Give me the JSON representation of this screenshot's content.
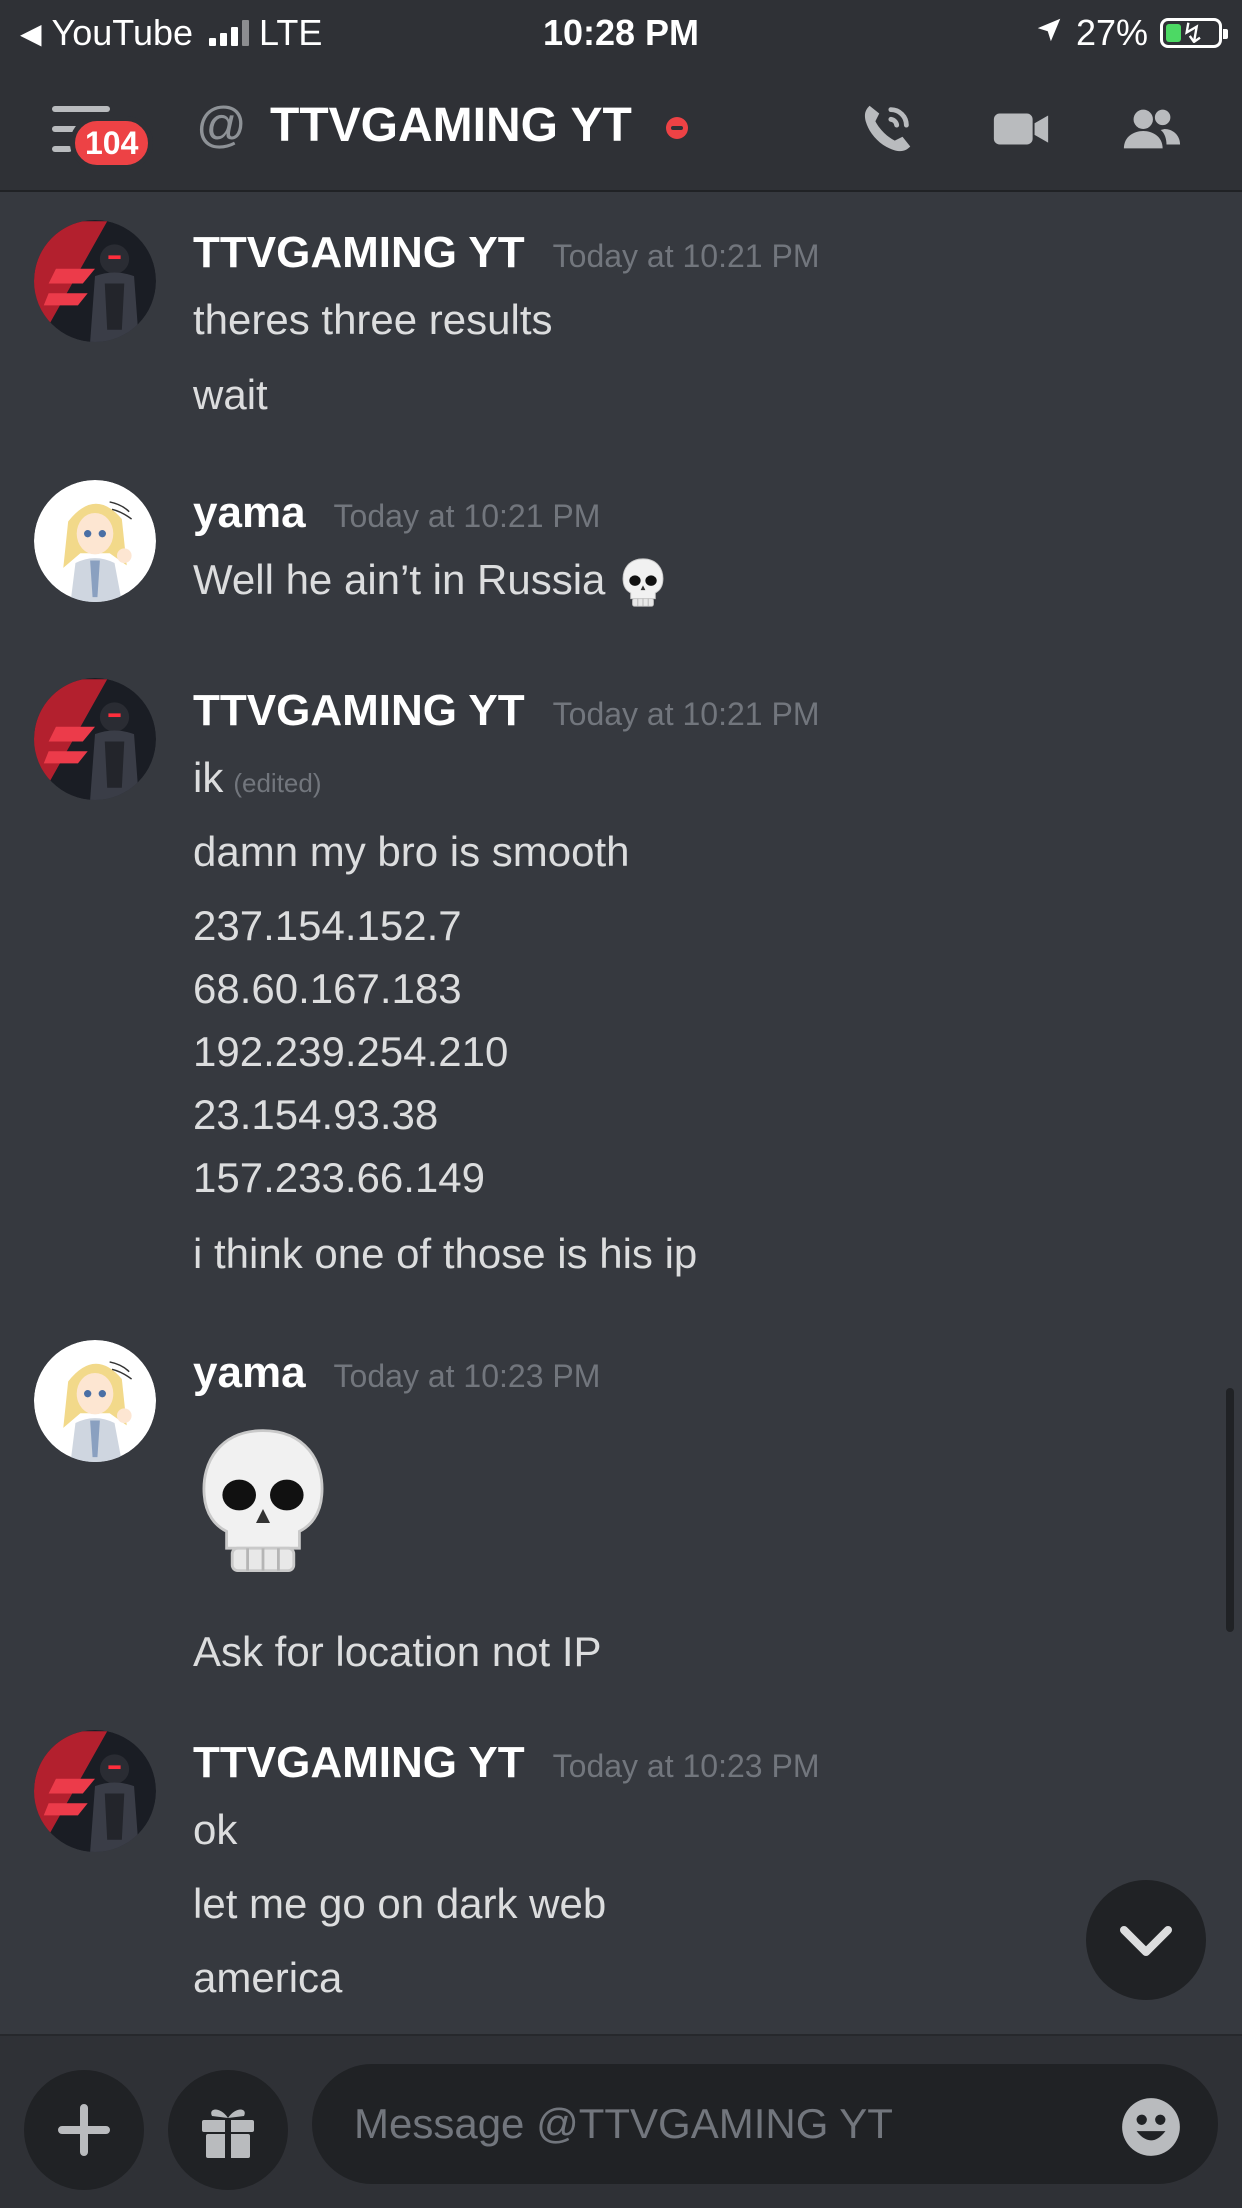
{
  "status_bar": {
    "back_app": "YouTube",
    "network": "LTE",
    "time": "10:28 PM",
    "battery": "27%",
    "battery_level": 0.27
  },
  "header": {
    "unread_badge": "104",
    "at_symbol": "@",
    "title": "TTVGAMING YT",
    "status": "dnd",
    "icons": [
      "menu-icon",
      "phone-call-icon",
      "video-call-icon",
      "members-icon"
    ]
  },
  "messages": [
    {
      "username": "TTVGAMING YT",
      "timestamp": "Today at 10:21 PM",
      "avatar": "ttv-avatar",
      "lines": [
        "theres three results",
        "wait"
      ]
    },
    {
      "username": "yama",
      "timestamp": "Today at 10:21 PM",
      "avatar": "yama-avatar",
      "lines": [
        "Well he ain’t in Russia"
      ],
      "emoji": "skull"
    },
    {
      "username": "TTVGAMING YT",
      "timestamp": "Today at 10:21 PM",
      "avatar": "ttv-avatar",
      "lines": [
        "ik",
        "damn my bro is smooth",
        "237.154.152.7",
        "68.60.167.183",
        "192.239.254.210",
        "23.154.93.38",
        "157.233.66.149",
        "i think one of those is his ip"
      ],
      "edited_label": "(edited)"
    },
    {
      "username": "yama",
      "timestamp": "Today at 10:23 PM",
      "avatar": "yama-avatar",
      "lines": [
        "Ask for location not IP"
      ],
      "emoji": "skull"
    },
    {
      "username": "TTVGAMING YT",
      "timestamp": "Today at 10:23 PM",
      "avatar": "ttv-avatar",
      "lines": [
        "ok",
        "let me go on dark web",
        "america"
      ]
    }
  ],
  "composer": {
    "placeholder": "Message @TTVGAMING YT",
    "value": "",
    "icons": [
      "plus-icon",
      "gift-icon",
      "emoji-icon"
    ]
  },
  "jump_to_present_icon": "chevron-down-icon",
  "colors": {
    "background": "#36393f",
    "header": "#2f3136",
    "input": "#202225",
    "badge": "#ed4245",
    "text": "#dcddde",
    "muted": "#72767d",
    "battery_fill": "#4cd964"
  }
}
